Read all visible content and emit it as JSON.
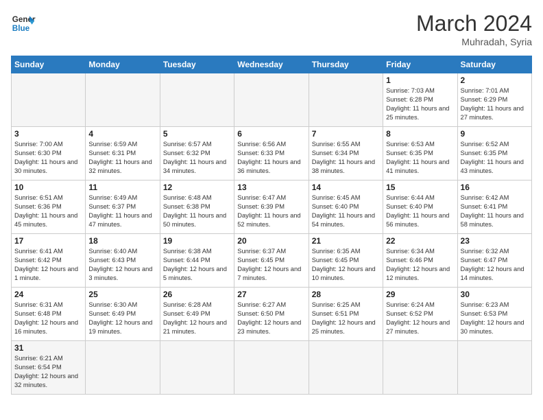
{
  "header": {
    "logo_general": "General",
    "logo_blue": "Blue",
    "month_year": "March 2024",
    "location": "Muhradah, Syria"
  },
  "days_of_week": [
    "Sunday",
    "Monday",
    "Tuesday",
    "Wednesday",
    "Thursday",
    "Friday",
    "Saturday"
  ],
  "weeks": [
    [
      {
        "day": "",
        "empty": true
      },
      {
        "day": "",
        "empty": true
      },
      {
        "day": "",
        "empty": true
      },
      {
        "day": "",
        "empty": true
      },
      {
        "day": "",
        "empty": true
      },
      {
        "day": "1",
        "sunrise": "7:03 AM",
        "sunset": "6:28 PM",
        "daylight": "11 hours and 25 minutes."
      },
      {
        "day": "2",
        "sunrise": "7:01 AM",
        "sunset": "6:29 PM",
        "daylight": "11 hours and 27 minutes."
      }
    ],
    [
      {
        "day": "3",
        "sunrise": "7:00 AM",
        "sunset": "6:30 PM",
        "daylight": "11 hours and 30 minutes."
      },
      {
        "day": "4",
        "sunrise": "6:59 AM",
        "sunset": "6:31 PM",
        "daylight": "11 hours and 32 minutes."
      },
      {
        "day": "5",
        "sunrise": "6:57 AM",
        "sunset": "6:32 PM",
        "daylight": "11 hours and 34 minutes."
      },
      {
        "day": "6",
        "sunrise": "6:56 AM",
        "sunset": "6:33 PM",
        "daylight": "11 hours and 36 minutes."
      },
      {
        "day": "7",
        "sunrise": "6:55 AM",
        "sunset": "6:34 PM",
        "daylight": "11 hours and 38 minutes."
      },
      {
        "day": "8",
        "sunrise": "6:53 AM",
        "sunset": "6:35 PM",
        "daylight": "11 hours and 41 minutes."
      },
      {
        "day": "9",
        "sunrise": "6:52 AM",
        "sunset": "6:35 PM",
        "daylight": "11 hours and 43 minutes."
      }
    ],
    [
      {
        "day": "10",
        "sunrise": "6:51 AM",
        "sunset": "6:36 PM",
        "daylight": "11 hours and 45 minutes."
      },
      {
        "day": "11",
        "sunrise": "6:49 AM",
        "sunset": "6:37 PM",
        "daylight": "11 hours and 47 minutes."
      },
      {
        "day": "12",
        "sunrise": "6:48 AM",
        "sunset": "6:38 PM",
        "daylight": "11 hours and 50 minutes."
      },
      {
        "day": "13",
        "sunrise": "6:47 AM",
        "sunset": "6:39 PM",
        "daylight": "11 hours and 52 minutes."
      },
      {
        "day": "14",
        "sunrise": "6:45 AM",
        "sunset": "6:40 PM",
        "daylight": "11 hours and 54 minutes."
      },
      {
        "day": "15",
        "sunrise": "6:44 AM",
        "sunset": "6:40 PM",
        "daylight": "11 hours and 56 minutes."
      },
      {
        "day": "16",
        "sunrise": "6:42 AM",
        "sunset": "6:41 PM",
        "daylight": "11 hours and 58 minutes."
      }
    ],
    [
      {
        "day": "17",
        "sunrise": "6:41 AM",
        "sunset": "6:42 PM",
        "daylight": "12 hours and 1 minute."
      },
      {
        "day": "18",
        "sunrise": "6:40 AM",
        "sunset": "6:43 PM",
        "daylight": "12 hours and 3 minutes."
      },
      {
        "day": "19",
        "sunrise": "6:38 AM",
        "sunset": "6:44 PM",
        "daylight": "12 hours and 5 minutes."
      },
      {
        "day": "20",
        "sunrise": "6:37 AM",
        "sunset": "6:45 PM",
        "daylight": "12 hours and 7 minutes."
      },
      {
        "day": "21",
        "sunrise": "6:35 AM",
        "sunset": "6:45 PM",
        "daylight": "12 hours and 10 minutes."
      },
      {
        "day": "22",
        "sunrise": "6:34 AM",
        "sunset": "6:46 PM",
        "daylight": "12 hours and 12 minutes."
      },
      {
        "day": "23",
        "sunrise": "6:32 AM",
        "sunset": "6:47 PM",
        "daylight": "12 hours and 14 minutes."
      }
    ],
    [
      {
        "day": "24",
        "sunrise": "6:31 AM",
        "sunset": "6:48 PM",
        "daylight": "12 hours and 16 minutes."
      },
      {
        "day": "25",
        "sunrise": "6:30 AM",
        "sunset": "6:49 PM",
        "daylight": "12 hours and 19 minutes."
      },
      {
        "day": "26",
        "sunrise": "6:28 AM",
        "sunset": "6:49 PM",
        "daylight": "12 hours and 21 minutes."
      },
      {
        "day": "27",
        "sunrise": "6:27 AM",
        "sunset": "6:50 PM",
        "daylight": "12 hours and 23 minutes."
      },
      {
        "day": "28",
        "sunrise": "6:25 AM",
        "sunset": "6:51 PM",
        "daylight": "12 hours and 25 minutes."
      },
      {
        "day": "29",
        "sunrise": "6:24 AM",
        "sunset": "6:52 PM",
        "daylight": "12 hours and 27 minutes."
      },
      {
        "day": "30",
        "sunrise": "6:23 AM",
        "sunset": "6:53 PM",
        "daylight": "12 hours and 30 minutes."
      }
    ],
    [
      {
        "day": "31",
        "sunrise": "6:21 AM",
        "sunset": "6:54 PM",
        "daylight": "12 hours and 32 minutes.",
        "last": true
      },
      {
        "day": "",
        "empty": true,
        "last": true
      },
      {
        "day": "",
        "empty": true,
        "last": true
      },
      {
        "day": "",
        "empty": true,
        "last": true
      },
      {
        "day": "",
        "empty": true,
        "last": true
      },
      {
        "day": "",
        "empty": true,
        "last": true
      },
      {
        "day": "",
        "empty": true,
        "last": true
      }
    ]
  ]
}
